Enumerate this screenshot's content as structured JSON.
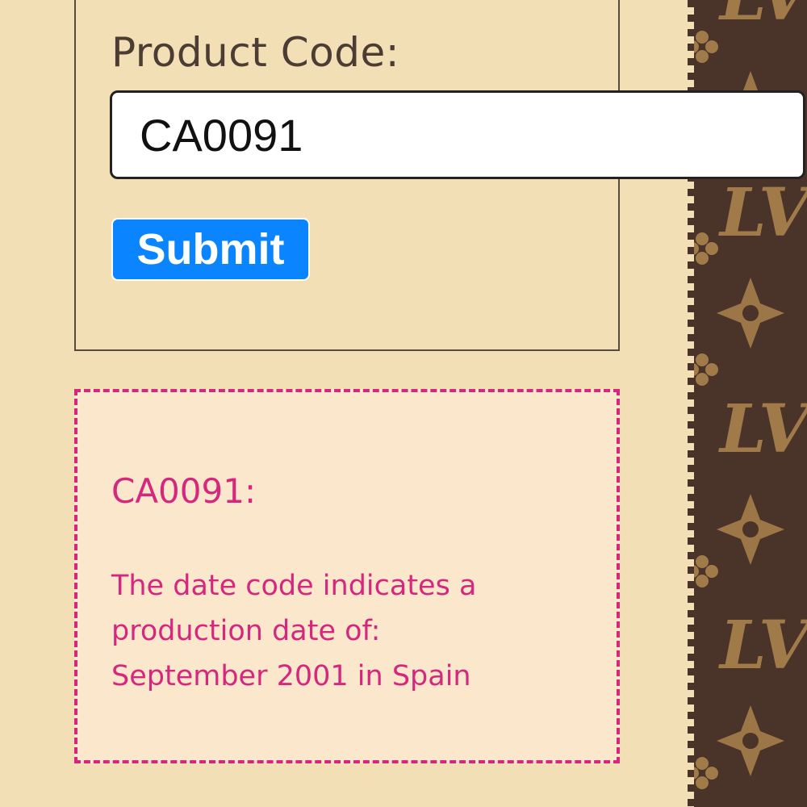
{
  "form": {
    "label": "Product Code:",
    "input_value": "CA0091",
    "submit_label": "Submit"
  },
  "result": {
    "code": "CA0091:",
    "lines": [
      "The date code indicates a",
      "production date of:",
      "September 2001 in Spain"
    ]
  },
  "background_pattern": {
    "monogram": "LV",
    "colors": {
      "stripe": "#4a3328",
      "ornament": "#a07a49",
      "page": "#f3dfb6"
    }
  }
}
